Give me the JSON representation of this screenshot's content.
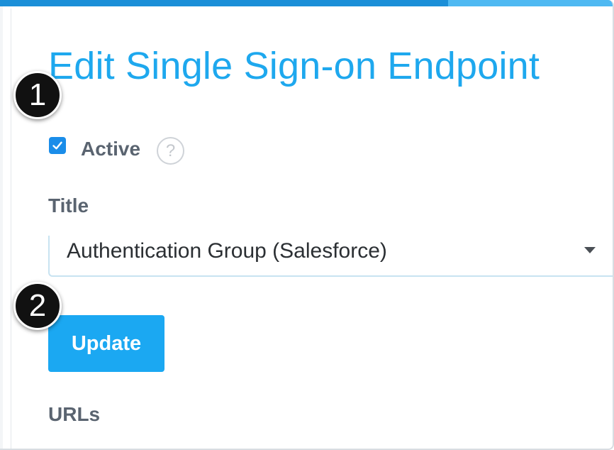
{
  "progress": {
    "fraction": 0.73,
    "fill_color": "#1b8fd8",
    "track_color": "#4fb9f2"
  },
  "page": {
    "title": "Edit Single Sign-on Endpoint",
    "accent_color": "#1ea8ee"
  },
  "markers": [
    {
      "label": "1"
    },
    {
      "label": "2"
    }
  ],
  "active": {
    "checked": true,
    "label": "Active",
    "help_icon": "question-circle-icon",
    "help_glyph": "?"
  },
  "title_field": {
    "label": "Title",
    "selected_value": "Authentication Group (Salesforce)",
    "caret_icon": "chevron-down-icon"
  },
  "actions": {
    "update_label": "Update",
    "button_color": "#1ba8f2"
  },
  "urls": {
    "label": "URLs"
  }
}
